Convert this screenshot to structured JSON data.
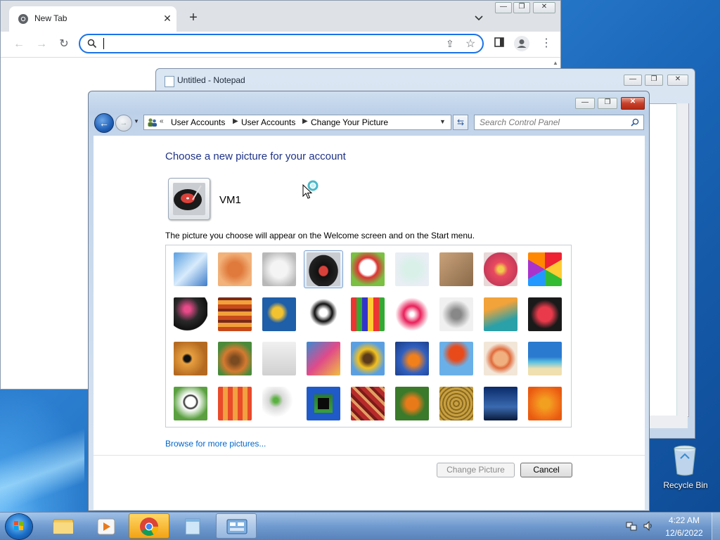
{
  "chrome": {
    "tab_title": "New Tab",
    "tab_close": "✕",
    "new_tab": "+",
    "omnibox_value": "",
    "window_min": "—",
    "window_max": "❐",
    "window_close": "✕"
  },
  "notepad": {
    "title": "Untitled - Notepad"
  },
  "control_panel": {
    "breadcrumb_prefix": "«",
    "breadcrumbs": [
      "User Accounts",
      "User Accounts",
      "Change Your Picture"
    ],
    "search_placeholder": "Search Control Panel",
    "heading": "Choose a new picture for your account",
    "username": "VM1",
    "description": "The picture you choose will appear on the Welcome screen and on the Start menu.",
    "browse_link": "Browse for more pictures...",
    "change_button": "Change Picture",
    "cancel_button": "Cancel",
    "selected_picture_index": 3,
    "pictures": [
      "rollercoaster",
      "starfish",
      "robot-dog",
      "turntable",
      "lucky-cat",
      "gyroscope",
      "kitten",
      "flower",
      "pinwheel",
      "ball",
      "fabric",
      "leaf",
      "dog",
      "crayons",
      "star-lantern",
      "jacks",
      "steps",
      "paper-crane",
      "guitar",
      "pomeranian",
      "robot",
      "scarves",
      "sunflower",
      "fish",
      "hot-air-balloon",
      "ornament",
      "sailboat",
      "soccer-ball",
      "textiles",
      "marbles",
      "window",
      "rug",
      "butterfly",
      "basket",
      "lighthouse",
      "orange-flower"
    ]
  },
  "desktop": {
    "recycle_bin_label": "Recycle Bin"
  },
  "taskbar": {
    "clock_time": "4:22 AM",
    "clock_date": "12/6/2022",
    "apps": [
      "windows-explorer",
      "media-player",
      "google-chrome",
      "notepad",
      "control-panel"
    ]
  }
}
